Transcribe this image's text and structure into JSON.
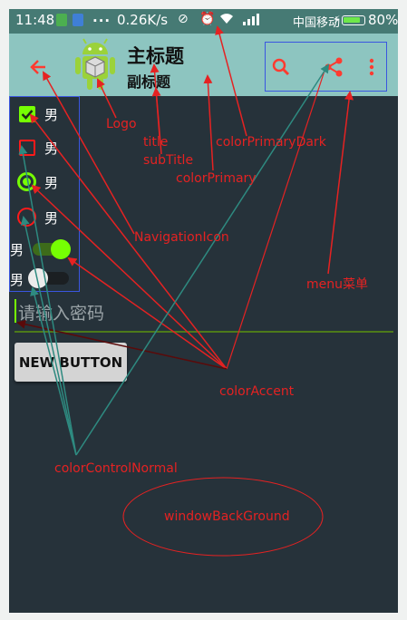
{
  "status_bar": {
    "time": "11:48",
    "dots": "...",
    "speed": "0.26K/s",
    "carrier": "中国移动",
    "battery": "80%",
    "battery_level": 0.8
  },
  "toolbar": {
    "navigation_icon": "arrow-back-icon",
    "logo_icon": "android-logo-icon",
    "title": "主标题",
    "subtitle": "副标题",
    "actions": [
      "search-icon",
      "share-icon",
      "more-vertical-icon"
    ]
  },
  "widgets": {
    "checkboxes": [
      {
        "label": "男",
        "checked": true
      },
      {
        "label": "男",
        "checked": false
      }
    ],
    "radios": [
      {
        "label": "男",
        "checked": true
      },
      {
        "label": "男",
        "checked": false
      }
    ],
    "switches": [
      {
        "label": "男",
        "on": true
      },
      {
        "label": "男",
        "on": false
      }
    ]
  },
  "password_input": {
    "placeholder": "请输入密码"
  },
  "button": {
    "label": "NEW BUTTON"
  },
  "annotations": {
    "logo": "Logo",
    "title": "title",
    "subtitle": "subTitle",
    "color_primary": "colorPrimary",
    "color_primary_dark": "colorPrimaryDark",
    "navigation_icon": "NavigationIcon",
    "menu": "menu菜单",
    "color_accent": "colorAccent",
    "color_control_normal": "colorControlNormal",
    "window_background": "windowBackGround"
  },
  "colors": {
    "color_primary": "#8dc5c0",
    "color_primary_dark": "#467a74",
    "color_accent": "#76ff03",
    "color_control_normal": "#ff1a1a",
    "window_background": "#26323a",
    "annotation_red": "#e52222",
    "annotation_teal": "#2e8a80",
    "annotation_dark_red": "#5a0a0a",
    "highlight_box": "#3a56e0"
  }
}
